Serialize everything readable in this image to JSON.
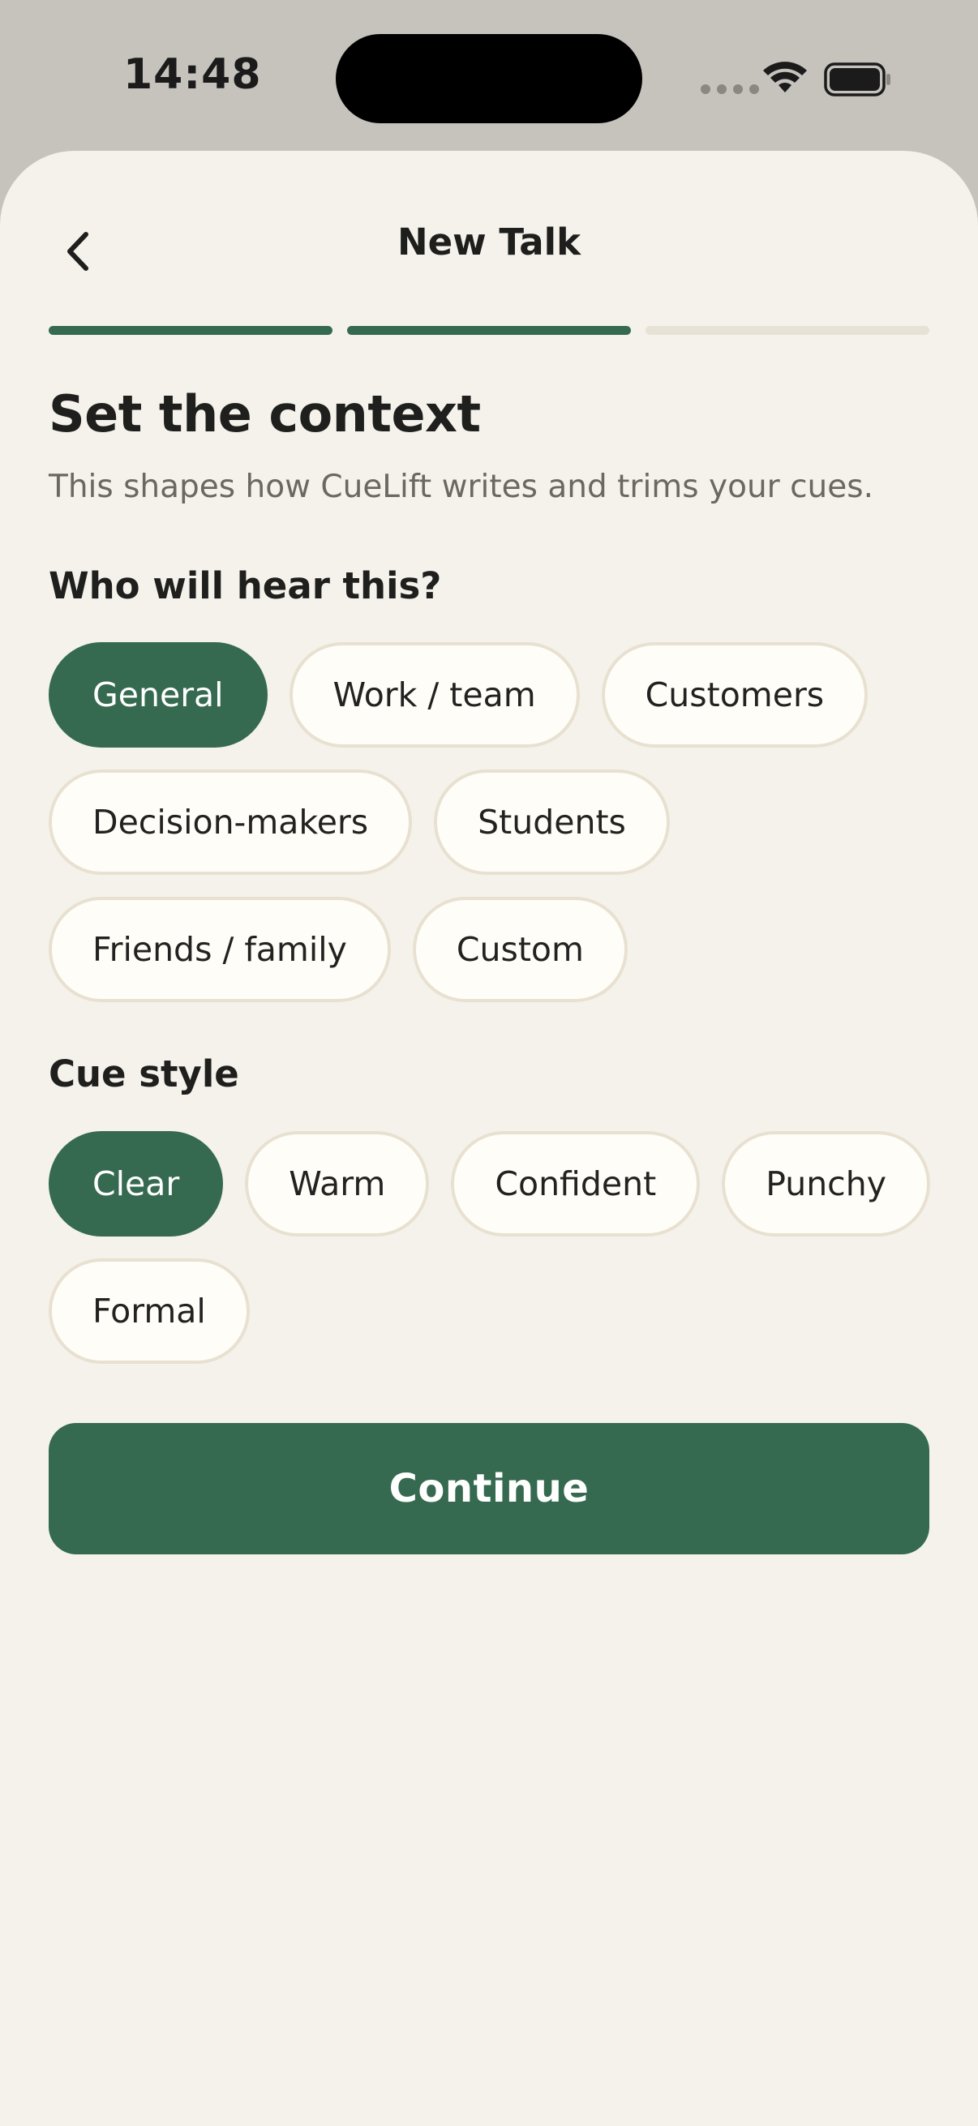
{
  "status_bar": {
    "time": "14:48"
  },
  "header": {
    "title": "New Talk"
  },
  "progress": {
    "steps": 3,
    "completed": 2
  },
  "page": {
    "heading": "Set the context",
    "subtitle": "This shapes how CueLift writes and trims your cues."
  },
  "audience": {
    "label": "Who will hear this?",
    "options": [
      "General",
      "Work / team",
      "Customers",
      "Decision-makers",
      "Students",
      "Friends / family",
      "Custom"
    ],
    "selected": "General"
  },
  "cue_style": {
    "label": "Cue style",
    "options": [
      "Clear",
      "Warm",
      "Confident",
      "Punchy",
      "Formal"
    ],
    "selected": "Clear"
  },
  "continue_label": "Continue",
  "colors": {
    "accent": "#356a50",
    "background": "#f4f2eb",
    "chip_border": "#e8e1d1"
  }
}
